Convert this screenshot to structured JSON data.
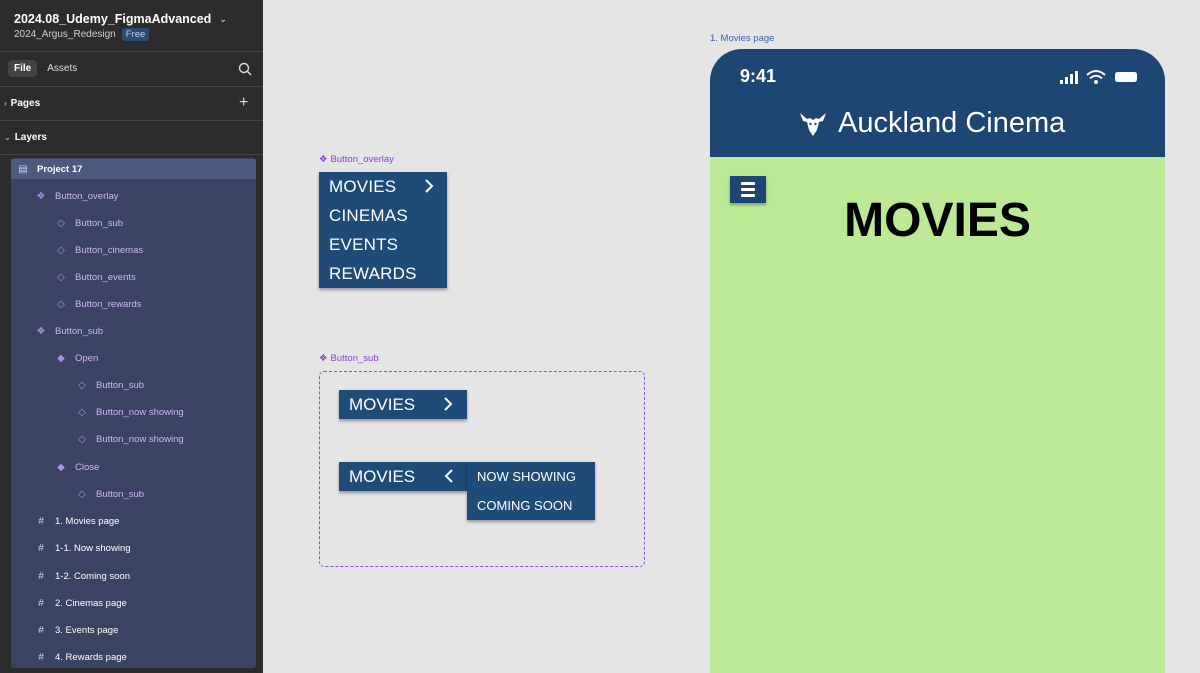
{
  "file": {
    "title": "2024.08_Udemy_FigmaAdvanced",
    "project": "2024_Argus_Redesign",
    "plan_badge": "Free"
  },
  "panel_tabs": [
    "File",
    "Assets"
  ],
  "sections": {
    "pages": "Pages",
    "layers": "Layers"
  },
  "layers": [
    {
      "label": "Project 17",
      "icon": "page-icon"
    },
    {
      "label": "Button_overlay",
      "icon": "component-icon"
    },
    {
      "label": "Button_sub",
      "icon": "instance-icon"
    },
    {
      "label": "Button_cinemas",
      "icon": "instance-icon"
    },
    {
      "label": "Button_events",
      "icon": "instance-icon"
    },
    {
      "label": "Button_rewards",
      "icon": "instance-icon"
    },
    {
      "label": "Button_sub",
      "icon": "component-icon"
    },
    {
      "label": "Open",
      "icon": "variant-icon"
    },
    {
      "label": "Button_sub",
      "icon": "instance-icon"
    },
    {
      "label": "Button_now showing",
      "icon": "instance-icon"
    },
    {
      "label": "Button_now showing",
      "icon": "instance-icon"
    },
    {
      "label": "Close",
      "icon": "variant-icon"
    },
    {
      "label": "Button_sub",
      "icon": "instance-icon"
    },
    {
      "label": "1. Movies page",
      "icon": "frame-icon"
    },
    {
      "label": "1-1. Now showing",
      "icon": "frame-icon"
    },
    {
      "label": "1-2. Coming soon",
      "icon": "frame-icon"
    },
    {
      "label": "2. Cinemas page",
      "icon": "frame-icon"
    },
    {
      "label": "3. Events page",
      "icon": "frame-icon"
    },
    {
      "label": "4. Rewards page",
      "icon": "frame-icon"
    }
  ],
  "canvas": {
    "overlay_label": "Button_overlay",
    "overlay_items": [
      "MOVIES",
      "CINEMAS",
      "EVENTS",
      "REWARDS"
    ],
    "sub_label": "Button_sub",
    "sub_open_label": "MOVIES",
    "sub_close_label": "MOVIES",
    "submenu_items": [
      "NOW SHOWING",
      "COMING SOON"
    ],
    "frame_label": "1. Movies page"
  },
  "phone": {
    "time": "9:41",
    "brand": "Auckland Cinema",
    "heading": "MOVIES",
    "colors": {
      "header": "#1d4672",
      "body": "#bde896"
    }
  }
}
